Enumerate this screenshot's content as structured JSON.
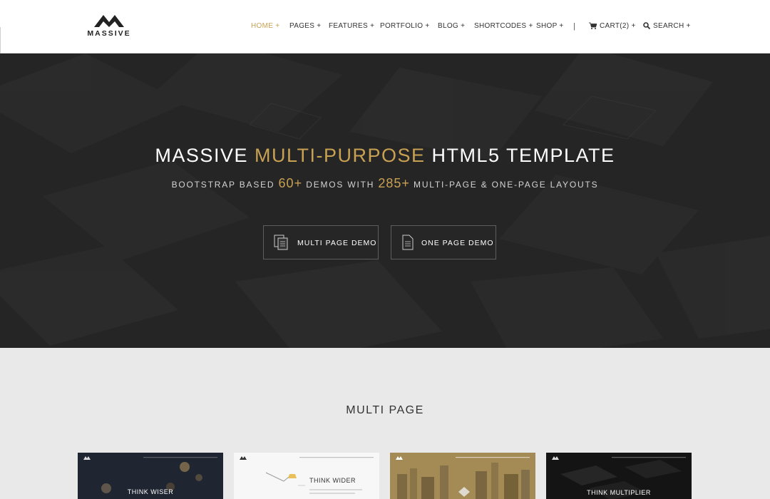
{
  "brand": {
    "logo_text": "MASSIVE"
  },
  "nav": {
    "items": [
      {
        "label": "HOME +"
      },
      {
        "label": "PAGES +"
      },
      {
        "label": "FEATURES +"
      },
      {
        "label": "PORTFOLIO  +"
      },
      {
        "label": "BLOG +"
      },
      {
        "label": "SHORTCODES +"
      },
      {
        "label": "SHOP +"
      }
    ],
    "separator": "|",
    "cart_label": "CART(2) +",
    "search_label": "SEARCH +"
  },
  "hero": {
    "title_part1": "MASSIVE ",
    "title_accent": "MULTI-PURPOSE",
    "title_part2": " HTML5 TEMPLATE",
    "sub_part1": "BOOTSTRAP BASED ",
    "sub_num1": "60+",
    "sub_part2": " DEMOS WITH ",
    "sub_num2": "285+",
    "sub_part3": " MULTI-PAGE & ONE-PAGE LAYOUTS",
    "buttons": [
      {
        "label": "MULTI PAGE DEMO"
      },
      {
        "label": "ONE PAGE DEMO"
      }
    ]
  },
  "section": {
    "title": "MULTI PAGE",
    "thumbs": [
      {
        "text": "THINK WISER"
      },
      {
        "text": "THINK WIDER"
      },
      {
        "text": ""
      },
      {
        "text": "THINK MULTIPLIER"
      }
    ]
  },
  "colors": {
    "accent": "#c9a153",
    "hero_bg": "#2a2a2a",
    "section_bg": "#e9e9e9"
  }
}
